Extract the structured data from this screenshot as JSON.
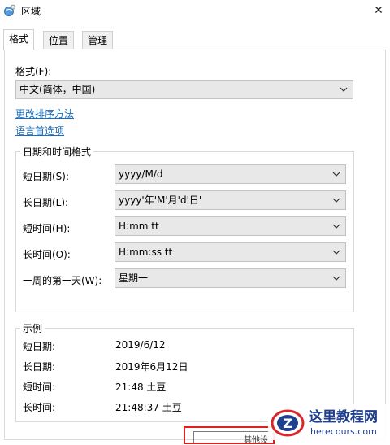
{
  "window": {
    "title": "区域"
  },
  "tabs": [
    {
      "label": "格式"
    },
    {
      "label": "位置"
    },
    {
      "label": "管理"
    }
  ],
  "format": {
    "label": "格式(F):",
    "value": "中文(简体，中国)",
    "link_sort": "更改排序方法",
    "link_lang": "语言首选项"
  },
  "datetime": {
    "title": "日期和时间格式",
    "rows": [
      {
        "label": "短日期(S):",
        "value": "yyyy/M/d"
      },
      {
        "label": "长日期(L):",
        "value": "yyyy'年'M'月'd'日'"
      },
      {
        "label": "短时间(H):",
        "value": "H:mm tt"
      },
      {
        "label": "长时间(O):",
        "value": "H:mm:ss tt"
      },
      {
        "label": "一周的第一天(W):",
        "value": "星期一"
      }
    ]
  },
  "example": {
    "title": "示例",
    "rows": [
      {
        "label": "短日期:",
        "value": "2019/6/12"
      },
      {
        "label": "长日期:",
        "value": "2019年6月12日"
      },
      {
        "label": "短时间:",
        "value": "21:48 土豆"
      },
      {
        "label": "长时间:",
        "value": "21:48:37 土豆"
      }
    ]
  },
  "button": {
    "label": "其他设"
  },
  "watermark": {
    "name": "这里教程网",
    "url": "herecours.com",
    "logo_letter": "Z"
  },
  "colors": {
    "link": "#1a6dbd",
    "highlight": "#e01e1e",
    "watermark": "#1f3f8f"
  }
}
